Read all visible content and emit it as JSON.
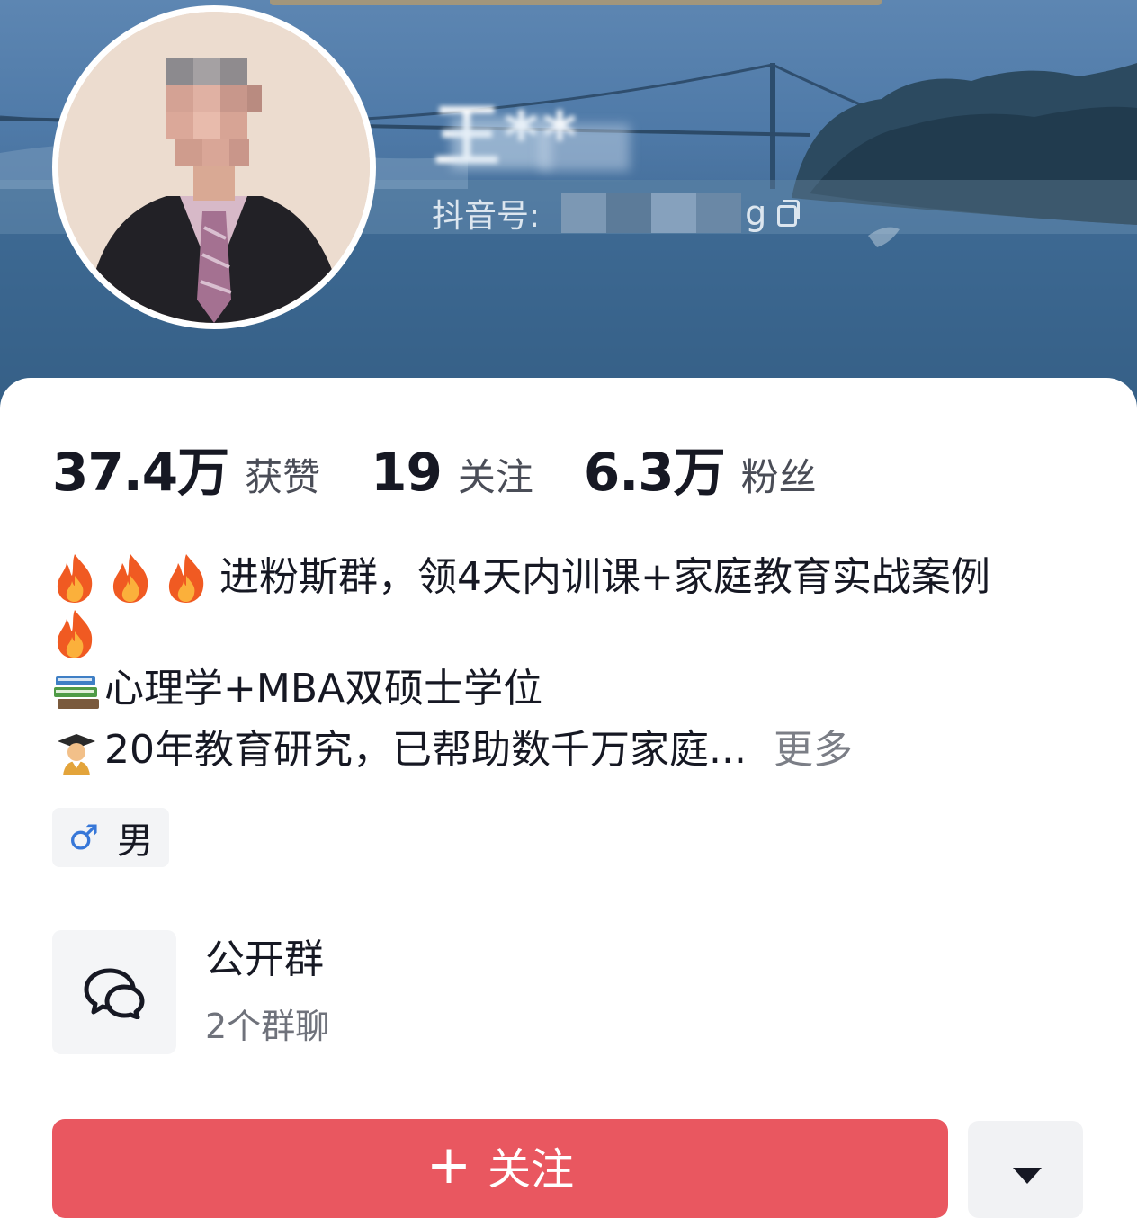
{
  "profile": {
    "name": "王**",
    "douyin_id_label": "抖音号:",
    "douyin_id_tail": "g"
  },
  "stats": [
    {
      "value": "37.4万",
      "label": "获赞"
    },
    {
      "value": "19",
      "label": "关注"
    },
    {
      "value": "6.3万",
      "label": "粉丝"
    }
  ],
  "bio": {
    "line1": "进粉斯群，领4天内训课+家庭教育实战案例",
    "line2": "心理学+MBA双硕士学位",
    "line3": "20年教育研究，已帮助数千万家庭...",
    "more": "更多",
    "emoji": [
      "fire-icon",
      "books-icon",
      "graduate-icon"
    ]
  },
  "gender": {
    "symbol": "♂",
    "label": "男"
  },
  "group": {
    "title": "公开群",
    "subtitle": "2个群聊",
    "icon": "chat-bubbles-icon"
  },
  "actions": {
    "follow_plus": "+",
    "follow_label": "关注",
    "dropdown_icon": "caret-down-icon"
  },
  "colors": {
    "follow_button": "#e95760",
    "gender_symbol": "#3777d8",
    "cover_sky": "#5d86b2"
  }
}
